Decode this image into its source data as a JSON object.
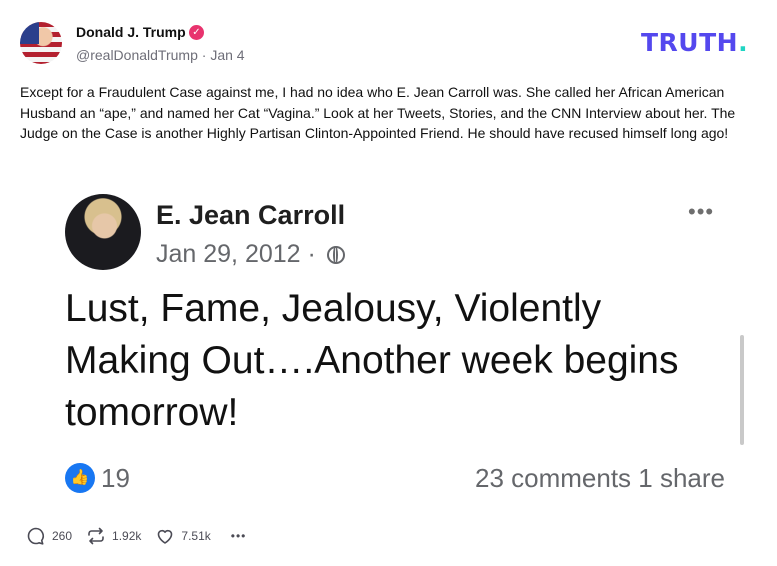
{
  "post": {
    "author": "Donald J. Trump",
    "handle": "@realDonaldTrump",
    "separator": "·",
    "date": "Jan 4",
    "logo_text": "TRUTH",
    "logo_dot": ".",
    "text": "Except for a Fraudulent Case against me, I had no idea who E. Jean Carroll was. She called her African American Husband an “ape,” and named her Cat “Vagina.” Look at her Tweets, Stories, and the CNN Interview about her. The Judge on the Case is another Highly Partisan Clinton-Appointed Friend. He should have recused himself long ago!"
  },
  "embed": {
    "name": "E. Jean Carroll",
    "date": "Jan 29, 2012 ·",
    "body": "Lust, Fame, Jealousy, Violently Making Out….Another week begins tomorrow!",
    "likes": "19",
    "stats": "23 comments  1 share"
  },
  "actions": {
    "replies": "260",
    "retruths": "1.92k",
    "likes": "7.51k"
  },
  "colors": {
    "brand": "#5448ee",
    "brand_accent": "#1fd5c3",
    "verified": "#e8336e",
    "facebook_blue": "#1877f2"
  },
  "icons": [
    "verified-badge-icon",
    "more-icon",
    "globe-icon",
    "thumbs-up-icon",
    "reply-icon",
    "retruth-icon",
    "heart-icon",
    "more-actions-icon"
  ]
}
